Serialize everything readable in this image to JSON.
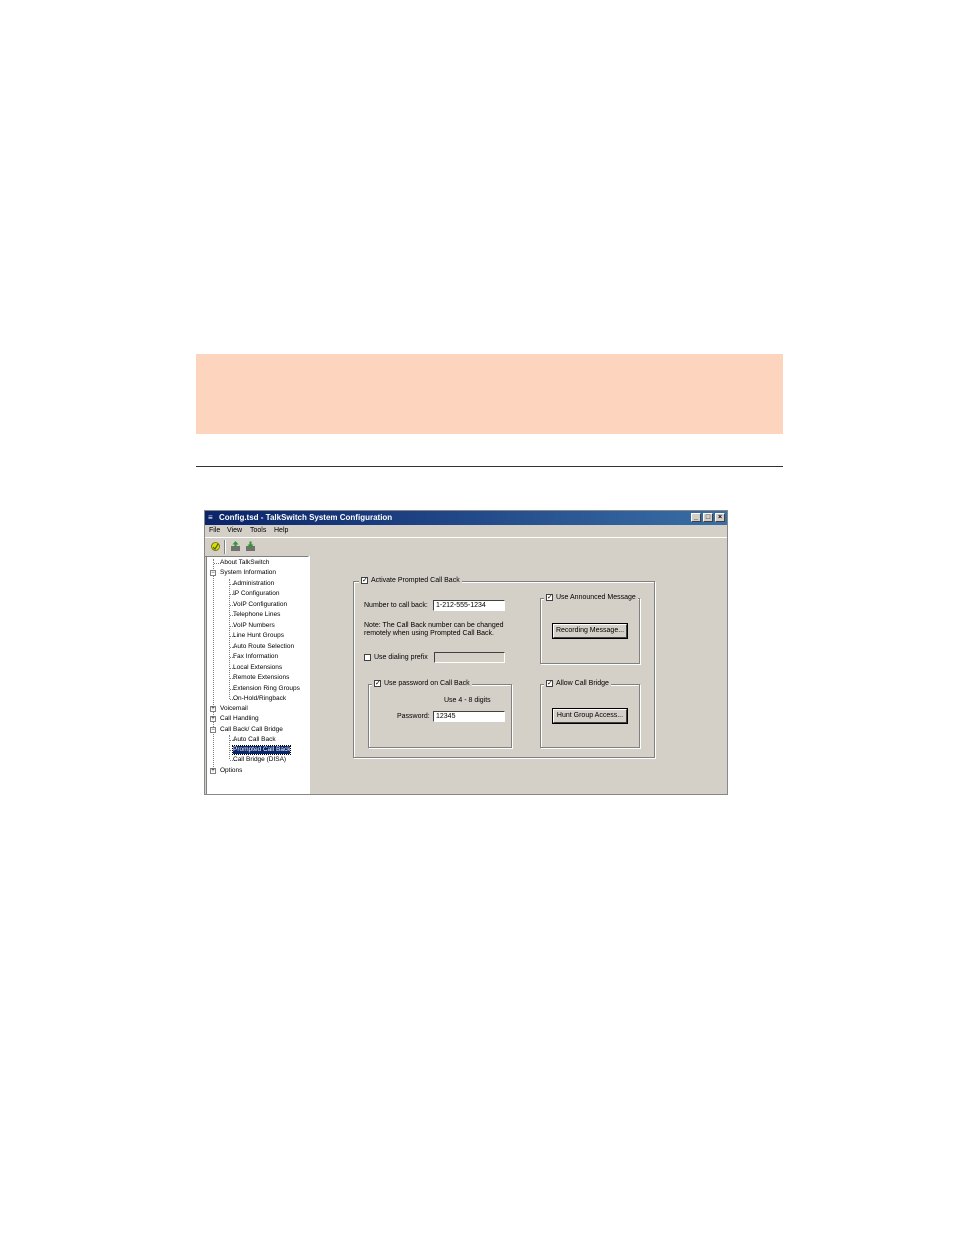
{
  "window": {
    "title": "Config.tsd - TalkSwitch System Configuration",
    "controls": {
      "minimize": "_",
      "maximize": "□",
      "close": "×"
    }
  },
  "menu": [
    "File",
    "View",
    "Tools",
    "Help"
  ],
  "toolbar": {
    "icons": [
      "connect-icon",
      "upload-icon",
      "download-icon"
    ]
  },
  "tree": {
    "items": [
      {
        "label": "About TalkSwitch"
      },
      {
        "label": "System Information",
        "expander": "−"
      },
      {
        "label": "Administration"
      },
      {
        "label": "IP Configuration"
      },
      {
        "label": "VoIP Configuration"
      },
      {
        "label": "Telephone Lines"
      },
      {
        "label": "VoIP Numbers"
      },
      {
        "label": "Line Hunt Groups"
      },
      {
        "label": "Auto Route Selection"
      },
      {
        "label": "Fax Information"
      },
      {
        "label": "Local Extensions"
      },
      {
        "label": "Remote Extensions"
      },
      {
        "label": "Extension Ring Groups"
      },
      {
        "label": "On-Hold/Ringback"
      },
      {
        "label": "Voicemail",
        "expander": "+"
      },
      {
        "label": "Call Handling",
        "expander": "+"
      },
      {
        "label": "Call Back/ Call Bridge",
        "expander": "−"
      },
      {
        "label": "Auto Call Back"
      },
      {
        "label": "Prompted Call Back",
        "selected": true
      },
      {
        "label": "Call Bridge (DISA)"
      },
      {
        "label": "Options",
        "expander": "+"
      }
    ]
  },
  "form": {
    "activate": {
      "label": "Activate Prompted Call Back",
      "checked": "✓"
    },
    "number_label": "Number to call back:",
    "number_value": "1-212-555-1234",
    "note": [
      "Note: The Call Back number can be changed",
      "remotely when using Prompted Call Back."
    ],
    "dialing_prefix": {
      "label": "Use dialing prefix",
      "checked": "",
      "value": ""
    },
    "password_group": {
      "label": "Use password on Call Back",
      "checked": "✓",
      "hint": "Use 4 - 8 digits",
      "password_label": "Password:",
      "password_value": "12345"
    },
    "announced": {
      "label": "Use Announced Message",
      "checked": "✓",
      "button": "Recording Message..."
    },
    "bridge": {
      "label": "Allow Call Bridge",
      "checked": "✓",
      "button": "Hunt Group Access..."
    }
  }
}
